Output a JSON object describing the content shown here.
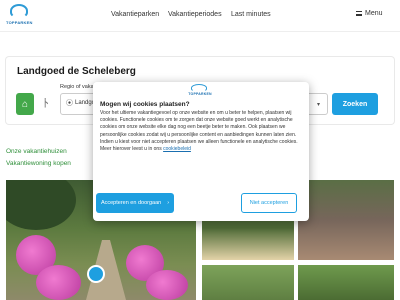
{
  "header": {
    "logo_text": "TOPPARKEN",
    "nav": [
      "Vakantieparken",
      "Vakantieperiodes",
      "Last minutes"
    ],
    "menu_label": "Menu"
  },
  "hero": {
    "title": "Landgoed de Scheleberg",
    "regio_label": "Regio of vakantiepark",
    "regio_value": "Landgoed de Scheleberg",
    "search_label": "Zoeken"
  },
  "links": [
    "Onze vakantiehuizen",
    "Vakantiewoning kopen"
  ],
  "cookie": {
    "logo_text": "TOPPARKEN",
    "title": "Mogen wij cookies plaatsen?",
    "body": "Voor het ultieme vakantiegevoel op onze website en om u beter te helpen, plaatsen wij cookies. Functionele cookies om te zorgen dat onze website goed werkt en analytische cookies om onze website elke dag nog een beetje beter te maken. Ook plaatsen we persoonlijke cookies zodat wij u persoonlijke content en aanbiedingen kunnen laten zien. Indien u kiest voor niet accepteren plaatsen we alleen functionele en analytische cookies. Meer hierover leest u in ons",
    "link_text": "cookiebeleid",
    "accept_label": "Accepteren en doorgaan",
    "accept_arrow": "›",
    "reject_label": "Niet accepteren"
  },
  "colors": {
    "brand_blue": "#1e9fe0",
    "brand_green": "#43a84a",
    "link_green": "#2f8f3a"
  },
  "icons": [
    "home-icon",
    "person-icon",
    "map-pin-icon",
    "chevron-down-icon",
    "menu-icon"
  ]
}
